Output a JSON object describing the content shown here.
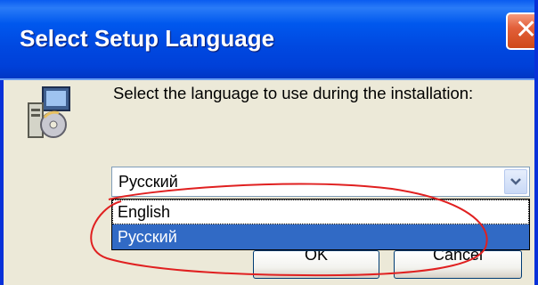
{
  "window": {
    "title": "Select Setup Language",
    "close_icon": "close-icon",
    "icon": "setup-disk-icon"
  },
  "prompt": "Select the language to use during the installation:",
  "language_select": {
    "selected_value": "Русский",
    "arrow_icon": "chevron-down-icon",
    "options": [
      "English",
      "Русский"
    ],
    "highlighted_option": "Русский"
  },
  "buttons": {
    "ok_label": "OK",
    "cancel_label": "Cancel"
  },
  "annotation": {
    "type": "hand-drawn ellipse",
    "color": "#e02020"
  },
  "colors": {
    "title_bar": "#0054e3",
    "dialog_bg": "#ece9d8",
    "selection": "#316ac5"
  }
}
